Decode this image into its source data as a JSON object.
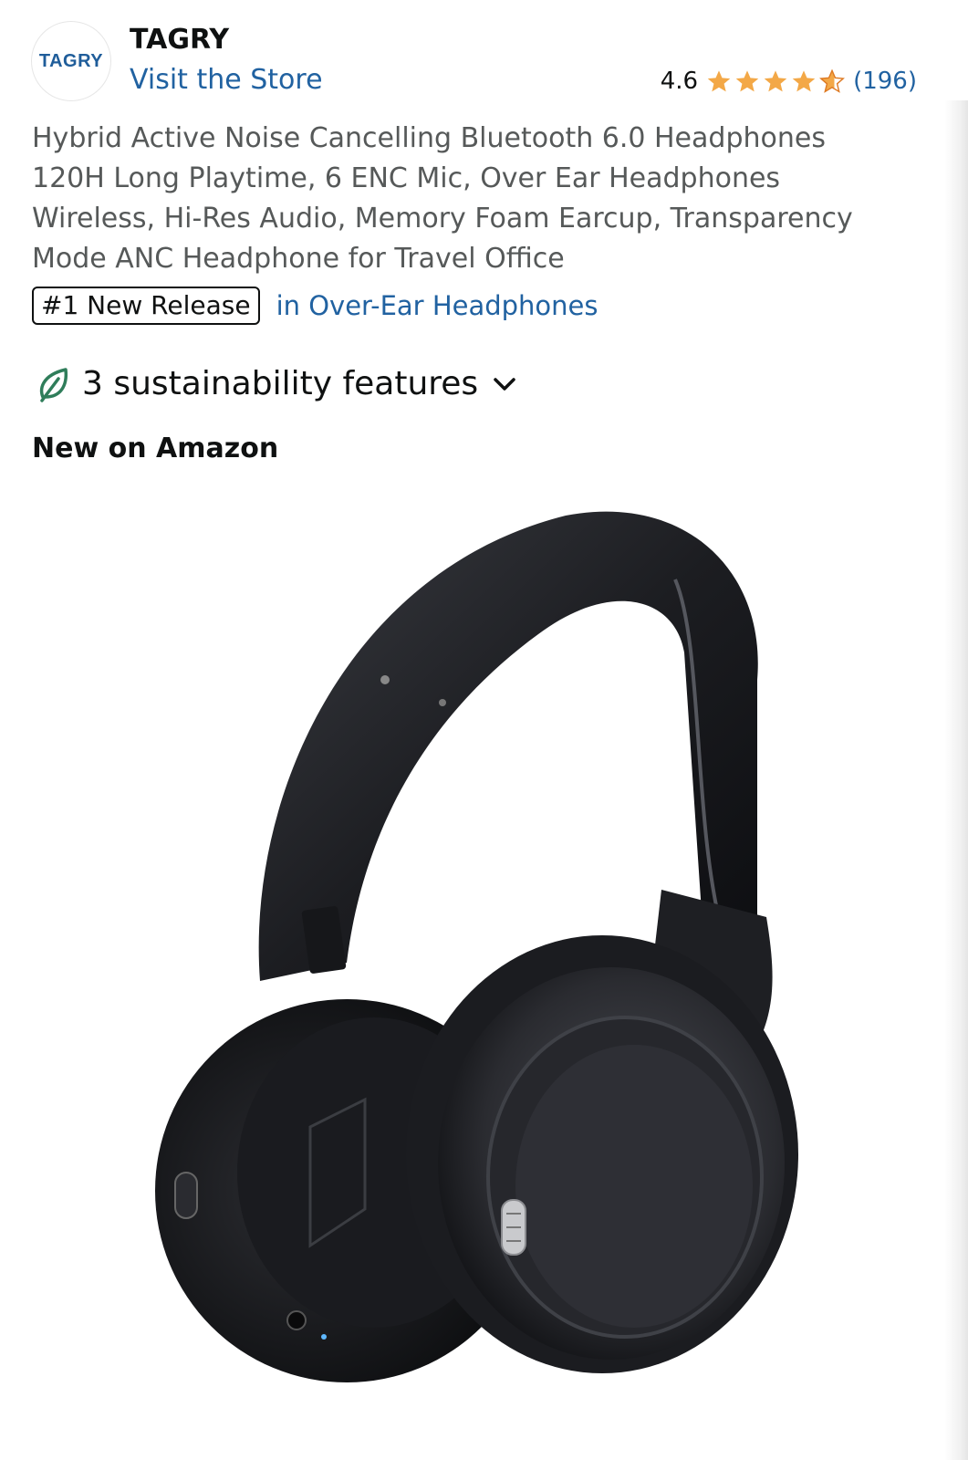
{
  "brand": {
    "logo_text": "TAGRY",
    "name": "TAGRY",
    "store_link": "Visit the Store"
  },
  "rating": {
    "value": "4.6",
    "stars": 4.6,
    "count": "(196)"
  },
  "product": {
    "title": "Hybrid Active Noise Cancelling Bluetooth 6.0 Headphones 120H Long Playtime, 6 ENC Mic, Over Ear Headphones Wireless, Hi-Res Audio, Memory Foam Earcup, Transparency Mode ANC Headphone for Travel Office",
    "badge": "#1 New Release",
    "badge_category": "in Over-Ear Headphones"
  },
  "sustainability": {
    "label": "3 sustainability features"
  },
  "section_label": "New on Amazon",
  "colors": {
    "link": "#2162a1",
    "star": "#f3a847",
    "leaf": "#2f7d5a"
  }
}
